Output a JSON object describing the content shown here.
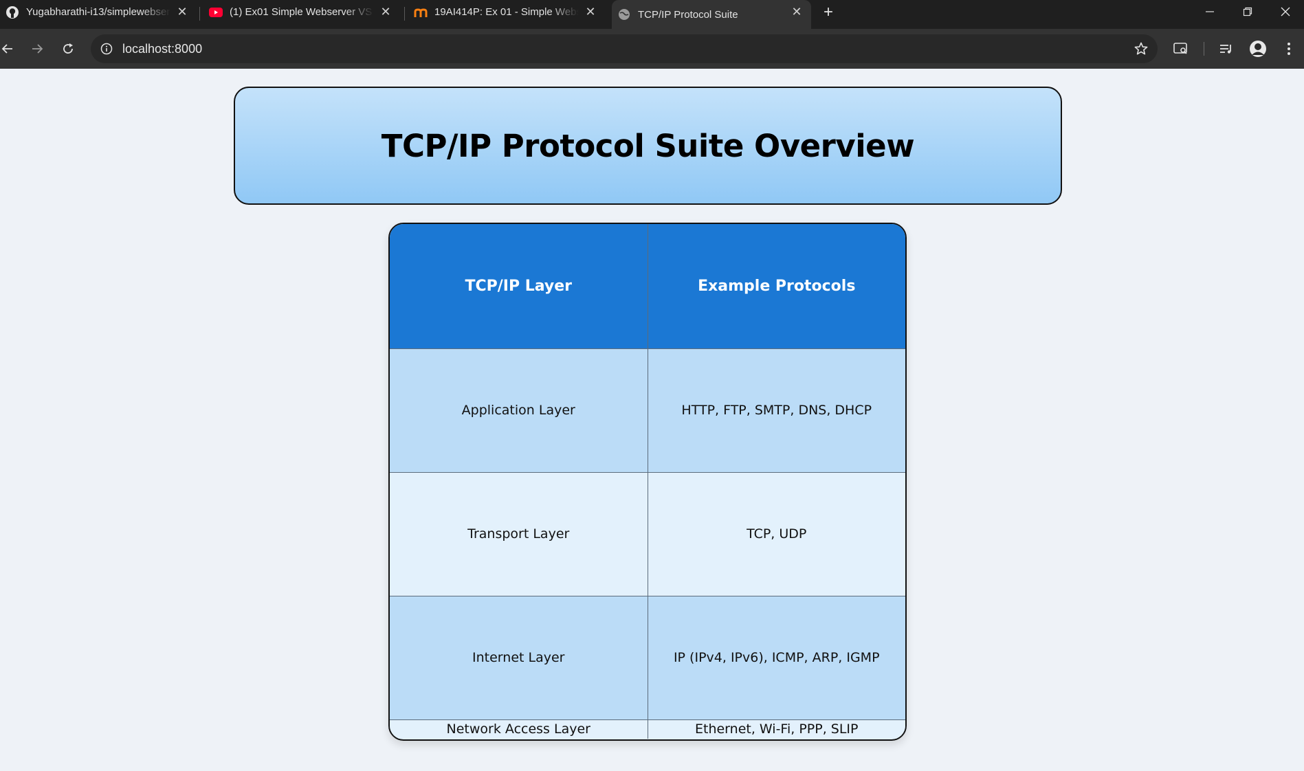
{
  "browser": {
    "tabs": [
      {
        "title": "Yugabharathi-i13/simplewebserver",
        "icon": "github-icon"
      },
      {
        "title": "(1) Ex01 Simple Webserver VS Code",
        "icon": "youtube-icon"
      },
      {
        "title": "19AI414P: Ex 01 - Simple Webserver",
        "icon": "moodle-icon"
      },
      {
        "title": "TCP/IP Protocol Suite",
        "icon": "globe-icon"
      }
    ],
    "address": "localhost:8000"
  },
  "page": {
    "heading": "TCP/IP Protocol Suite Overview",
    "table": {
      "headers": [
        "TCP/IP Layer",
        "Example Protocols"
      ],
      "rows": [
        [
          "Application Layer",
          "HTTP, FTP, SMTP, DNS, DHCP"
        ],
        [
          "Transport Layer",
          "TCP, UDP"
        ],
        [
          "Internet Layer",
          "IP (IPv4, IPv6), ICMP, ARP, IGMP"
        ],
        [
          "Network Access Layer",
          "Ethernet, Wi-Fi, PPP, SLIP"
        ]
      ]
    }
  },
  "colors": {
    "header_gradient_top": "#c4e2fa",
    "header_gradient_bottom": "#90c8f5",
    "table_header": "#1b78d4",
    "row_odd": "#bbdcf7",
    "row_even": "#e3f1fc"
  }
}
